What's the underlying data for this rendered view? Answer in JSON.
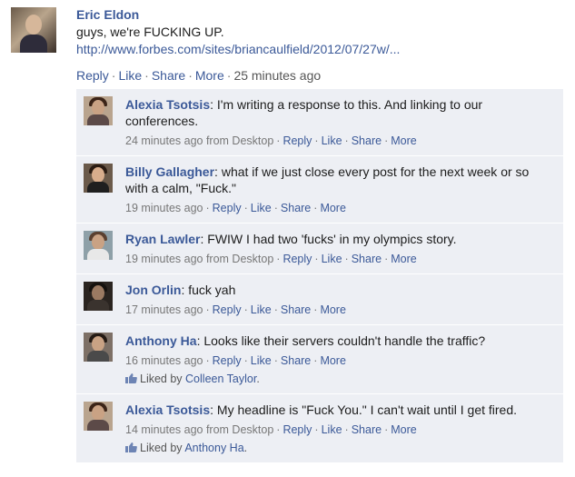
{
  "post": {
    "author": "Eric Eldon",
    "message": "guys, we're FUCKING UP.",
    "link": "http://www.forbes.com/sites/briancaulfield/2012/07/27w/...",
    "actions": {
      "reply": "Reply",
      "like": "Like",
      "share": "Share",
      "more": "More",
      "time": "25 minutes ago"
    }
  },
  "comments": [
    {
      "author": "Alexia Tsotsis",
      "text": " I'm writing a response to this. And linking to our conferences.",
      "time": "24 minutes ago from Desktop",
      "reply": "Reply",
      "like": "Like",
      "share": "Share",
      "more": "More"
    },
    {
      "author": "Billy Gallagher",
      "text": " what if we just close every post for the next week or so with a calm, \"Fuck.\"",
      "time": "19 minutes ago",
      "reply": "Reply",
      "like": "Like",
      "share": "Share",
      "more": "More"
    },
    {
      "author": "Ryan Lawler",
      "text": " FWIW I had two 'fucks' in my olympics story.",
      "time": "19 minutes ago from Desktop",
      "reply": "Reply",
      "like": "Like",
      "share": "Share",
      "more": "More"
    },
    {
      "author": "Jon Orlin",
      "text": " fuck yah",
      "time": "17 minutes ago",
      "reply": "Reply",
      "like": "Like",
      "share": "Share",
      "more": "More"
    },
    {
      "author": "Anthony Ha",
      "text": " Looks like their servers couldn't handle the traffic?",
      "time": "16 minutes ago",
      "reply": "Reply",
      "like": "Like",
      "share": "Share",
      "more": "More",
      "liked_by_prefix": "Liked by ",
      "liked_by": "Colleen Taylor",
      "liked_by_suffix": "."
    },
    {
      "author": "Alexia Tsotsis",
      "text": " My headline is \"Fuck You.\" I can't wait until I get fired.",
      "time": "14 minutes ago from Desktop",
      "reply": "Reply",
      "like": "Like",
      "share": "Share",
      "more": "More",
      "liked_by_prefix": "Liked by ",
      "liked_by": "Anthony Ha",
      "liked_by_suffix": "."
    }
  ],
  "colors": {
    "link": "#3b5998",
    "comment_bg": "#edeff4"
  },
  "icons": {
    "like": "thumbs-up-icon"
  }
}
